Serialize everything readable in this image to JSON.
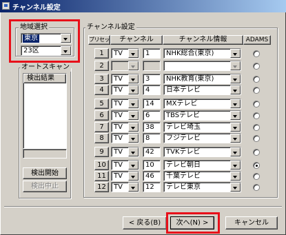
{
  "window": {
    "title": "チャンネル設定"
  },
  "region": {
    "group_label": "地域選択",
    "pref_value": "東京",
    "area_value": "23区"
  },
  "autoscan": {
    "group_label": "オートスキャン",
    "results_header": "検出結果",
    "start_label": "検出開始",
    "stop_label": "検出中止"
  },
  "channels": {
    "group_label": "チャンネル設定",
    "headers": {
      "preset": "プリセット",
      "channel": "チャンネル",
      "info": "チャンネル情報",
      "adams": "ADAMS"
    },
    "rows": [
      {
        "preset": "1",
        "band": "TV",
        "ch": "1",
        "name": "NHK総合(東京)",
        "enabled": true,
        "adams": false
      },
      {
        "preset": "2",
        "band": "",
        "ch": "",
        "name": "",
        "enabled": false,
        "adams": false
      },
      {
        "preset": "3",
        "band": "TV",
        "ch": "3",
        "name": "NHK教育(東京)",
        "enabled": true,
        "adams": false
      },
      {
        "preset": "4",
        "band": "TV",
        "ch": "4",
        "name": "日本テレビ",
        "enabled": true,
        "adams": false
      },
      {
        "preset": "5",
        "band": "TV",
        "ch": "14",
        "name": "MXテレビ",
        "enabled": true,
        "adams": false
      },
      {
        "preset": "6",
        "band": "TV",
        "ch": "6",
        "name": "TBSテレビ",
        "enabled": true,
        "adams": false
      },
      {
        "preset": "7",
        "band": "TV",
        "ch": "38",
        "name": "テレビ埼玉",
        "enabled": true,
        "adams": false
      },
      {
        "preset": "8",
        "band": "TV",
        "ch": "8",
        "name": "フジテレビ",
        "enabled": true,
        "adams": false
      },
      {
        "preset": "9",
        "band": "TV",
        "ch": "42",
        "name": "TVKテレビ",
        "enabled": true,
        "adams": false
      },
      {
        "preset": "10",
        "band": "TV",
        "ch": "10",
        "name": "テレビ朝日",
        "enabled": true,
        "adams": true
      },
      {
        "preset": "11",
        "band": "TV",
        "ch": "46",
        "name": "千葉テレビ",
        "enabled": true,
        "adams": false
      },
      {
        "preset": "12",
        "band": "TV",
        "ch": "12",
        "name": "テレビ東京",
        "enabled": true,
        "adams": false
      }
    ]
  },
  "footer": {
    "back_label": "< 戻る(B)",
    "next_label": "次へ(N) >",
    "cancel_label": "キャンセル"
  },
  "colors": {
    "highlight": "#e8101a",
    "face": "#d4d0c8",
    "title_bar": "#0a246a"
  }
}
